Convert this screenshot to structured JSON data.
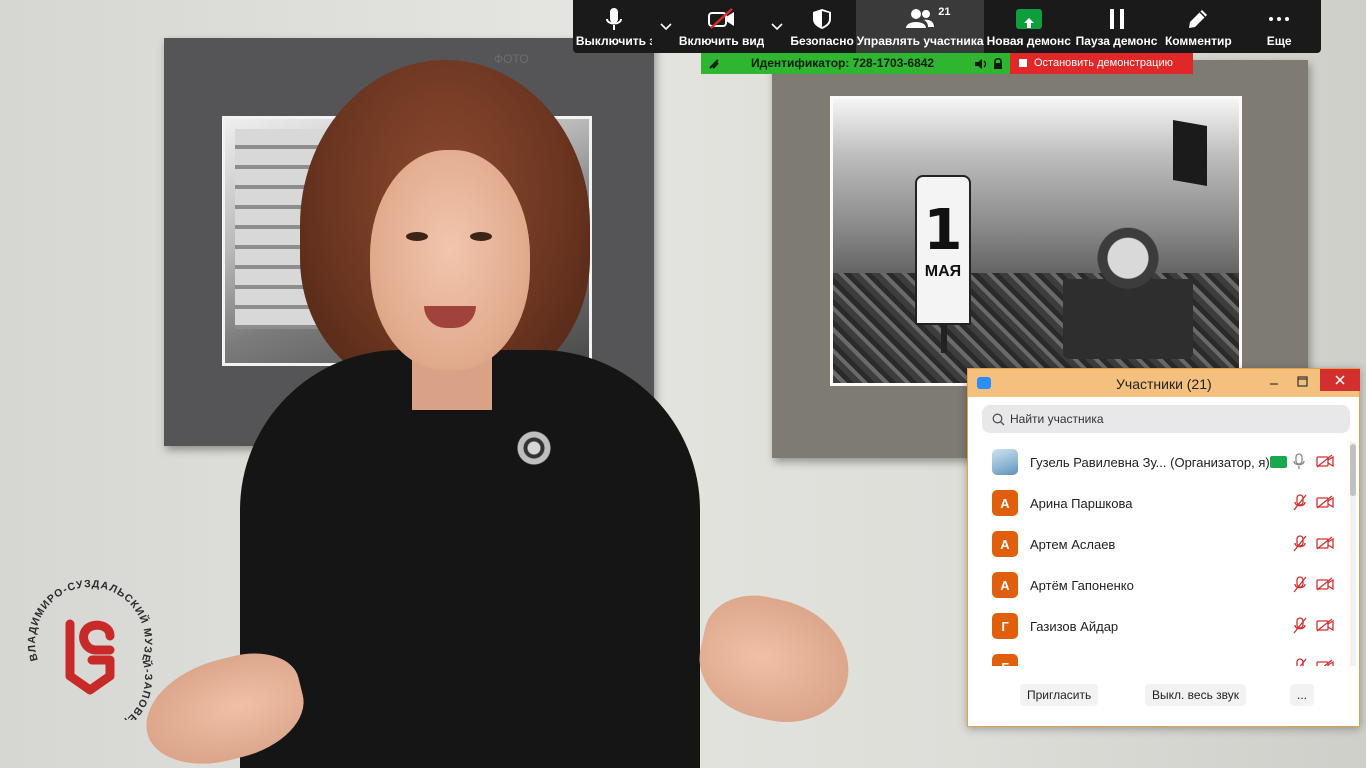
{
  "background": {
    "watermark": "ФОТО",
    "sign_number": "1",
    "sign_word": "МАЯ",
    "logo_text": "ВЛАДИМИРО-СУЗДАЛЬСКИЙ МУЗЕЙ-ЗАПОВЕДНИК"
  },
  "toolbar": {
    "mute_label": "Выключить з",
    "video_label": "Включить вид",
    "security_label": "Безопаснос",
    "participants_label": "Управлять участника",
    "participants_count": "21",
    "share_label": "Новая демонс",
    "pause_label": "Пауза демонс",
    "annotate_label": "Комментир",
    "more_label": "Еще"
  },
  "meeting": {
    "id_text": "Идентификатор: 728-1703-6842",
    "stop_label": "Остановить демонстрацию"
  },
  "panel": {
    "title": "Участники (21)",
    "search_placeholder": "Найти участника",
    "participants": [
      {
        "initial": "",
        "name": "Гузель Равилевна Зу... (Организатор, я)",
        "sharing": true,
        "mic": "on",
        "video": "off"
      },
      {
        "initial": "А",
        "name": "Арина Паршкова",
        "sharing": false,
        "mic": "muted",
        "video": "off"
      },
      {
        "initial": "А",
        "name": "Артем Аслаев",
        "sharing": false,
        "mic": "muted",
        "video": "off"
      },
      {
        "initial": "А",
        "name": "Артём Гапоненко",
        "sharing": false,
        "mic": "muted",
        "video": "off"
      },
      {
        "initial": "Г",
        "name": "Газизов Айдар",
        "sharing": false,
        "mic": "muted",
        "video": "off"
      },
      {
        "initial": "Г",
        "name": "",
        "sharing": false,
        "mic": "muted",
        "video": "off"
      }
    ],
    "invite_label": "Пригласить",
    "mute_all_label": "Выкл. весь звук",
    "more_label": "..."
  },
  "colors": {
    "accent_green": "#2fb52f",
    "stop_red": "#e02828",
    "panel_title_bg": "#f4c07d",
    "avatar_orange": "#e15f0c"
  }
}
